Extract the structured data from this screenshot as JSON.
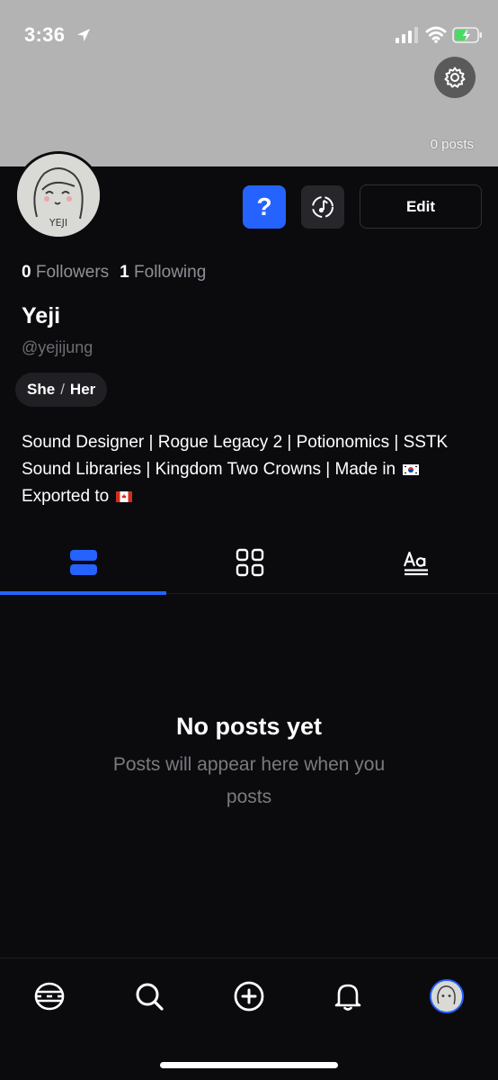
{
  "status_bar": {
    "time": "3:36"
  },
  "header": {
    "posts_count": "0 posts"
  },
  "profile": {
    "followers_count": "0",
    "followers_label": "Followers",
    "following_count": "1",
    "following_label": "Following",
    "name": "Yeji",
    "handle": "@yejijung",
    "pronoun_1": "She",
    "pronoun_sep": "/",
    "pronoun_2": "Her",
    "bio_line": "Sound Designer | Rogue Legacy 2 | Potionomics | SSTK Sound Libraries | Kingdom Two Crowns | Made in",
    "bio_exported": "Exported to",
    "avatar_text": "YEJI"
  },
  "actions": {
    "help_label": "?",
    "edit_label": "Edit"
  },
  "empty_state": {
    "title": "No posts yet",
    "subtitle": "Posts will appear here when you posts"
  },
  "colors": {
    "accent": "#2563ff",
    "background": "#0b0b0e",
    "banner": "#b3b3b3"
  },
  "icons": {
    "tabs": [
      "list-view-icon",
      "grid-view-icon",
      "text-view-icon"
    ],
    "bottom_nav": [
      "home-icon",
      "search-icon",
      "create-icon",
      "notifications-icon",
      "profile-avatar"
    ]
  }
}
